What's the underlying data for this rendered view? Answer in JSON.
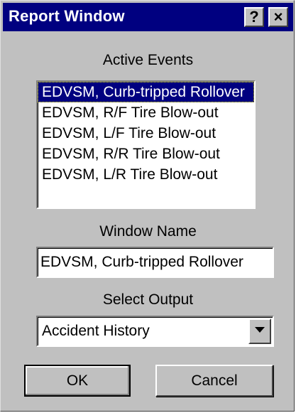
{
  "window": {
    "title": "Report Window",
    "help_label": "?",
    "close_label": "×"
  },
  "active_events": {
    "label": "Active Events",
    "items": [
      "EDVSM, Curb-tripped Rollover",
      "EDVSM, R/F Tire Blow-out",
      "EDVSM, L/F Tire Blow-out",
      "EDVSM, R/R Tire Blow-out",
      "EDVSM, L/R Tire Blow-out"
    ],
    "selected_index": 0
  },
  "window_name": {
    "label": "Window Name",
    "value": "EDVSM, Curb-tripped Rollover"
  },
  "select_output": {
    "label": "Select Output",
    "value": "Accident History"
  },
  "buttons": {
    "ok": "OK",
    "cancel": "Cancel"
  },
  "colors": {
    "titlebar": "#000080",
    "dialog_bg": "#c0c0c0",
    "selection": "#000080"
  }
}
